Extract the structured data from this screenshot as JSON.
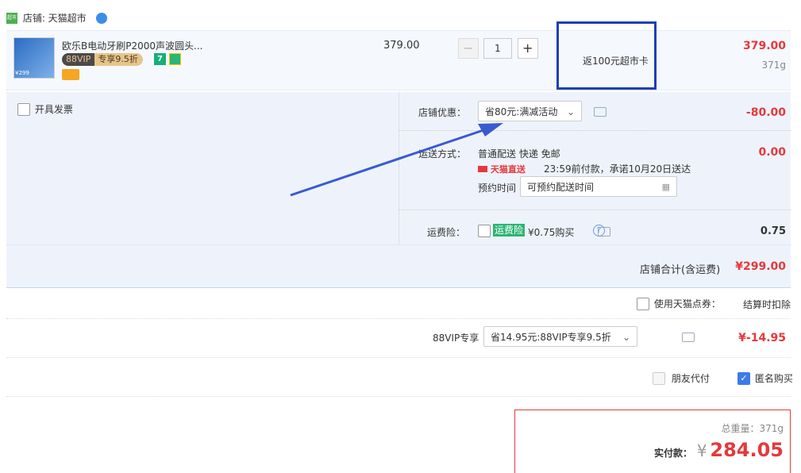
{
  "shop": {
    "label": "店铺: 天猫超市",
    "logo_text": "超市"
  },
  "item": {
    "title": "欧乐B电动牙刷P2000声波圆头...",
    "vip_badge": "88VIP",
    "vip_discount": "专享9.5折",
    "badge_7": "7",
    "unit_price": "379.00",
    "qty": "1",
    "rebate": "返100元超市卡",
    "subtotal": "379.00",
    "weight": "371g",
    "thumb_price": "¥299"
  },
  "invoice": {
    "label": "开具发票"
  },
  "shop_discount": {
    "label": "店铺优惠：",
    "selected": "省80元:满减活动",
    "amount": "-80.00"
  },
  "delivery": {
    "label": "运送方式：",
    "method": "普通配送 快递 免邮",
    "amount": "0.00",
    "tmall_direct": "天猫直送",
    "promise": "23:59前付款，承诺10月20日送达",
    "appt_label": "预约时间",
    "appt_value": "可预约配送时间"
  },
  "insurance": {
    "label": "运费险：",
    "tag": "运费险",
    "text": "¥0.75购买",
    "amount": "0.75"
  },
  "shop_total": {
    "label": "店铺合计(含运费)",
    "amount": "¥299.00"
  },
  "points": {
    "label": "使用天猫点券：",
    "note": "结算时扣除"
  },
  "vip": {
    "label": "88VIP专享",
    "selected": "省14.95元:88VIP专享9.5折",
    "amount": "¥-14.95"
  },
  "options": {
    "friend_pay": "朋友代付",
    "anon_buy": "匿名购买"
  },
  "summary": {
    "weight_label": "总重量：371g",
    "pay_label": "实付款：",
    "currency": "¥",
    "pay_amount": "284.05"
  },
  "colors": {
    "accent_red": "#e4393c",
    "panel_bg": "#eef3fb",
    "highlight_box": "#1e3fb8",
    "arrow": "#3a5bd0"
  }
}
